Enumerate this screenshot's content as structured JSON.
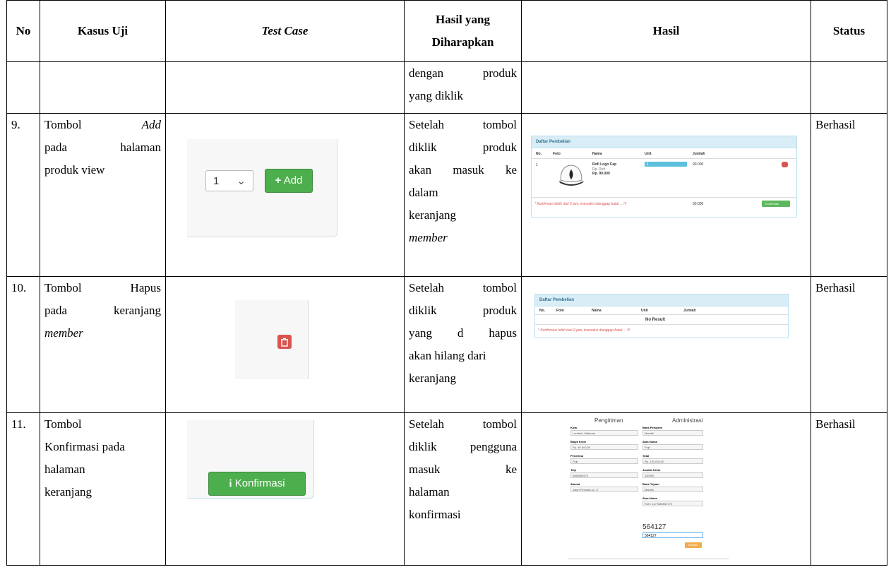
{
  "headers": {
    "no": "No",
    "kasus_uji": "Kasus Uji",
    "test_case": "Test Case",
    "hasil_diharapkan_1": "Hasil yang",
    "hasil_diharapkan_2": "Diharapkan",
    "hasil": "Hasil",
    "status": "Status"
  },
  "continuation": {
    "expected_lines": [
      "dengan produk",
      "yang diklik"
    ]
  },
  "rows": [
    {
      "no": "9.",
      "case_lines": [
        "Tombol Add",
        "pada halaman",
        "produk view"
      ],
      "case_word_1": "Tombol",
      "case_word_2": "Add",
      "case_line_2a": "pada",
      "case_line_2b": "halaman",
      "case_line_3": "produk view",
      "expected_lines": [
        "Setelah tombol",
        "diklik produk",
        "akan masuk ke",
        "dalam",
        "keranjang",
        "member"
      ],
      "status": "Berhasil",
      "testcase": {
        "qty": "1",
        "button": "Add"
      },
      "result": {
        "panel_title": "Daftar Pembelian",
        "cols": [
          "No.",
          "Foto",
          "Nama",
          "Unit",
          "Jumlah"
        ],
        "item_no": "1",
        "item_name": "Rofi Logo Cap",
        "item_sub": "Rp. Rofi",
        "item_price": "Rp. 90.000",
        "item_unit": "1",
        "item_total": "90.000",
        "note": "* Konfirmasi lebih dari 2 jam, transaksi dianggap batal ... !!!",
        "grand_total": "90.000",
        "confirm": "Konfirmasi"
      }
    },
    {
      "no": "10.",
      "case_lines": [
        "Tombol Hapus",
        "pada keranjang",
        "member"
      ],
      "expected_lines": [
        "Setelah tombol",
        "diklik produk",
        "yang d hapus",
        "akan hilang dari",
        "keranjang"
      ],
      "status": "Berhasil",
      "result": {
        "panel_title": "Daftar Pembelian",
        "cols": [
          "No.",
          "Foto",
          "Nama",
          "Unit",
          "Jumlah"
        ],
        "empty": "No Result",
        "note": "* Konfirmasi lebih dari 2 jam, transaksi dianggap batal ... !!!"
      }
    },
    {
      "no": "11.",
      "case_lines": [
        "Tombol",
        "Konfirmasi pada",
        "halaman",
        "keranjang"
      ],
      "expected_lines": [
        "Setelah tombol",
        "diklik pengguna",
        "masuk ke",
        "halaman",
        "konfirmasi"
      ],
      "status": "Berhasil",
      "testcase": {
        "button": "Konfirmasi"
      },
      "result": {
        "left_title": "Pengiriman",
        "right_title": "Administrasi",
        "left_fields": [
          {
            "label": "Kota",
            "value": "Lombok, Mataram"
          },
          {
            "label": "Biaya Kirim",
            "value": "Rp. 40.000,00"
          },
          {
            "label": "Penerima",
            "value": "Fiqh"
          },
          {
            "label": "Telp",
            "value": "0856460271"
          },
          {
            "label": "Alamat",
            "value": "Jalan Pemuda no 77"
          }
        ],
        "right_fields": [
          {
            "label": "Bank Pengirim",
            "value": "Mandiri"
          },
          {
            "label": "Atas Nama",
            "value": "Fiqh"
          },
          {
            "label": "Total",
            "value": "Rp. 130.000,00"
          },
          {
            "label": "Jumlah Kirim",
            "value": "130000"
          },
          {
            "label": "Bank Tujuan",
            "value": "Mandiri"
          },
          {
            "label": "Atas Nama",
            "value": "Rofi / 1177888904770"
          }
        ],
        "captcha": "564127",
        "captcha_input": "564127",
        "submit": "Simpan"
      }
    }
  ]
}
